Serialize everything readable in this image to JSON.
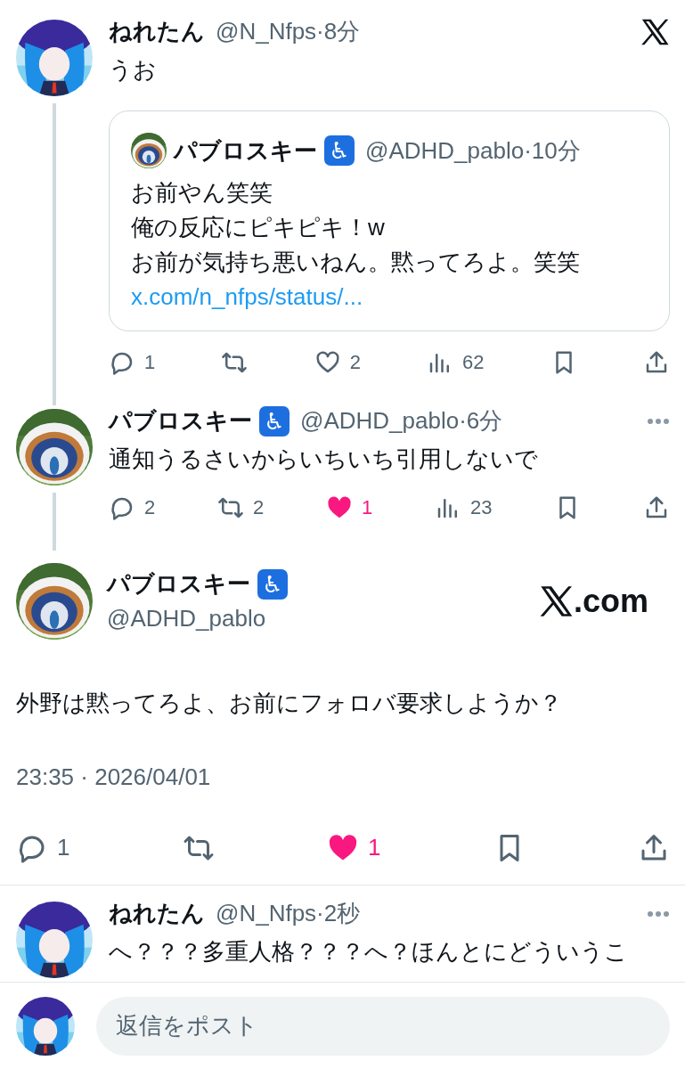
{
  "posts": [
    {
      "kind": "thread",
      "avatar": {
        "kind": "figure"
      },
      "name": "ねれたん",
      "meta": "@N_Nfps·8分",
      "corner": {
        "kind": "logo"
      },
      "connected": true,
      "text": "うお",
      "quote": {
        "avatar": {
          "kind": "picture"
        },
        "name": "パブロスキー",
        "badge": "♿",
        "meta": "@ADHD_pablo·10分",
        "lines": [
          "お前やん笑笑",
          "俺の反応にピキピキ！w",
          "お前が気持ち悪いねん。黙ってろよ。笑笑"
        ],
        "link": "x.com/n_nfps/status/..."
      },
      "actions": [
        {
          "kind": "reply",
          "count": "1"
        },
        {
          "kind": "repost"
        },
        {
          "kind": "like",
          "count": "2",
          "liked": false
        },
        {
          "kind": "views",
          "count": "62"
        },
        {
          "kind": "bookmark"
        },
        {
          "kind": "share"
        }
      ]
    },
    {
      "kind": "thread",
      "avatar": {
        "kind": "picture"
      },
      "name": "パブロスキー",
      "badge": "♿",
      "meta": "@ADHD_pablo·6分",
      "corner": {
        "kind": "more"
      },
      "connected": true,
      "text": "通知うるさいからいちいち引用しないで",
      "actions": [
        {
          "kind": "reply",
          "count": "2"
        },
        {
          "kind": "repost",
          "count": "2"
        },
        {
          "kind": "like",
          "count": "1",
          "liked": true
        },
        {
          "kind": "views",
          "count": "23"
        },
        {
          "kind": "bookmark"
        },
        {
          "kind": "share"
        }
      ]
    },
    {
      "kind": "main",
      "avatar": {
        "kind": "picture"
      },
      "name": "パブロスキー",
      "badge": "♿",
      "handle": "@ADHD_pablo",
      "brand": ".com",
      "text": "外野は黙ってろよ、お前にフォロバ要求しようか？",
      "timestamp": "23:35 · 2026/04/01",
      "actions": [
        {
          "kind": "reply",
          "count": "1"
        },
        {
          "kind": "repost"
        },
        {
          "kind": "like",
          "count": "1",
          "liked": true
        },
        {
          "kind": "bookmark"
        },
        {
          "kind": "share"
        }
      ]
    },
    {
      "kind": "thread",
      "avatar": {
        "kind": "figure"
      },
      "name": "ねれたん",
      "meta": "@N_Nfps·2秒",
      "corner": {
        "kind": "more"
      },
      "connected": false,
      "text": "へ？？？多重人格？？？へ？ほんとにどういうこ"
    }
  ],
  "composer": {
    "avatar": {
      "kind": "figure"
    },
    "placeholder": "返信をポスト"
  }
}
